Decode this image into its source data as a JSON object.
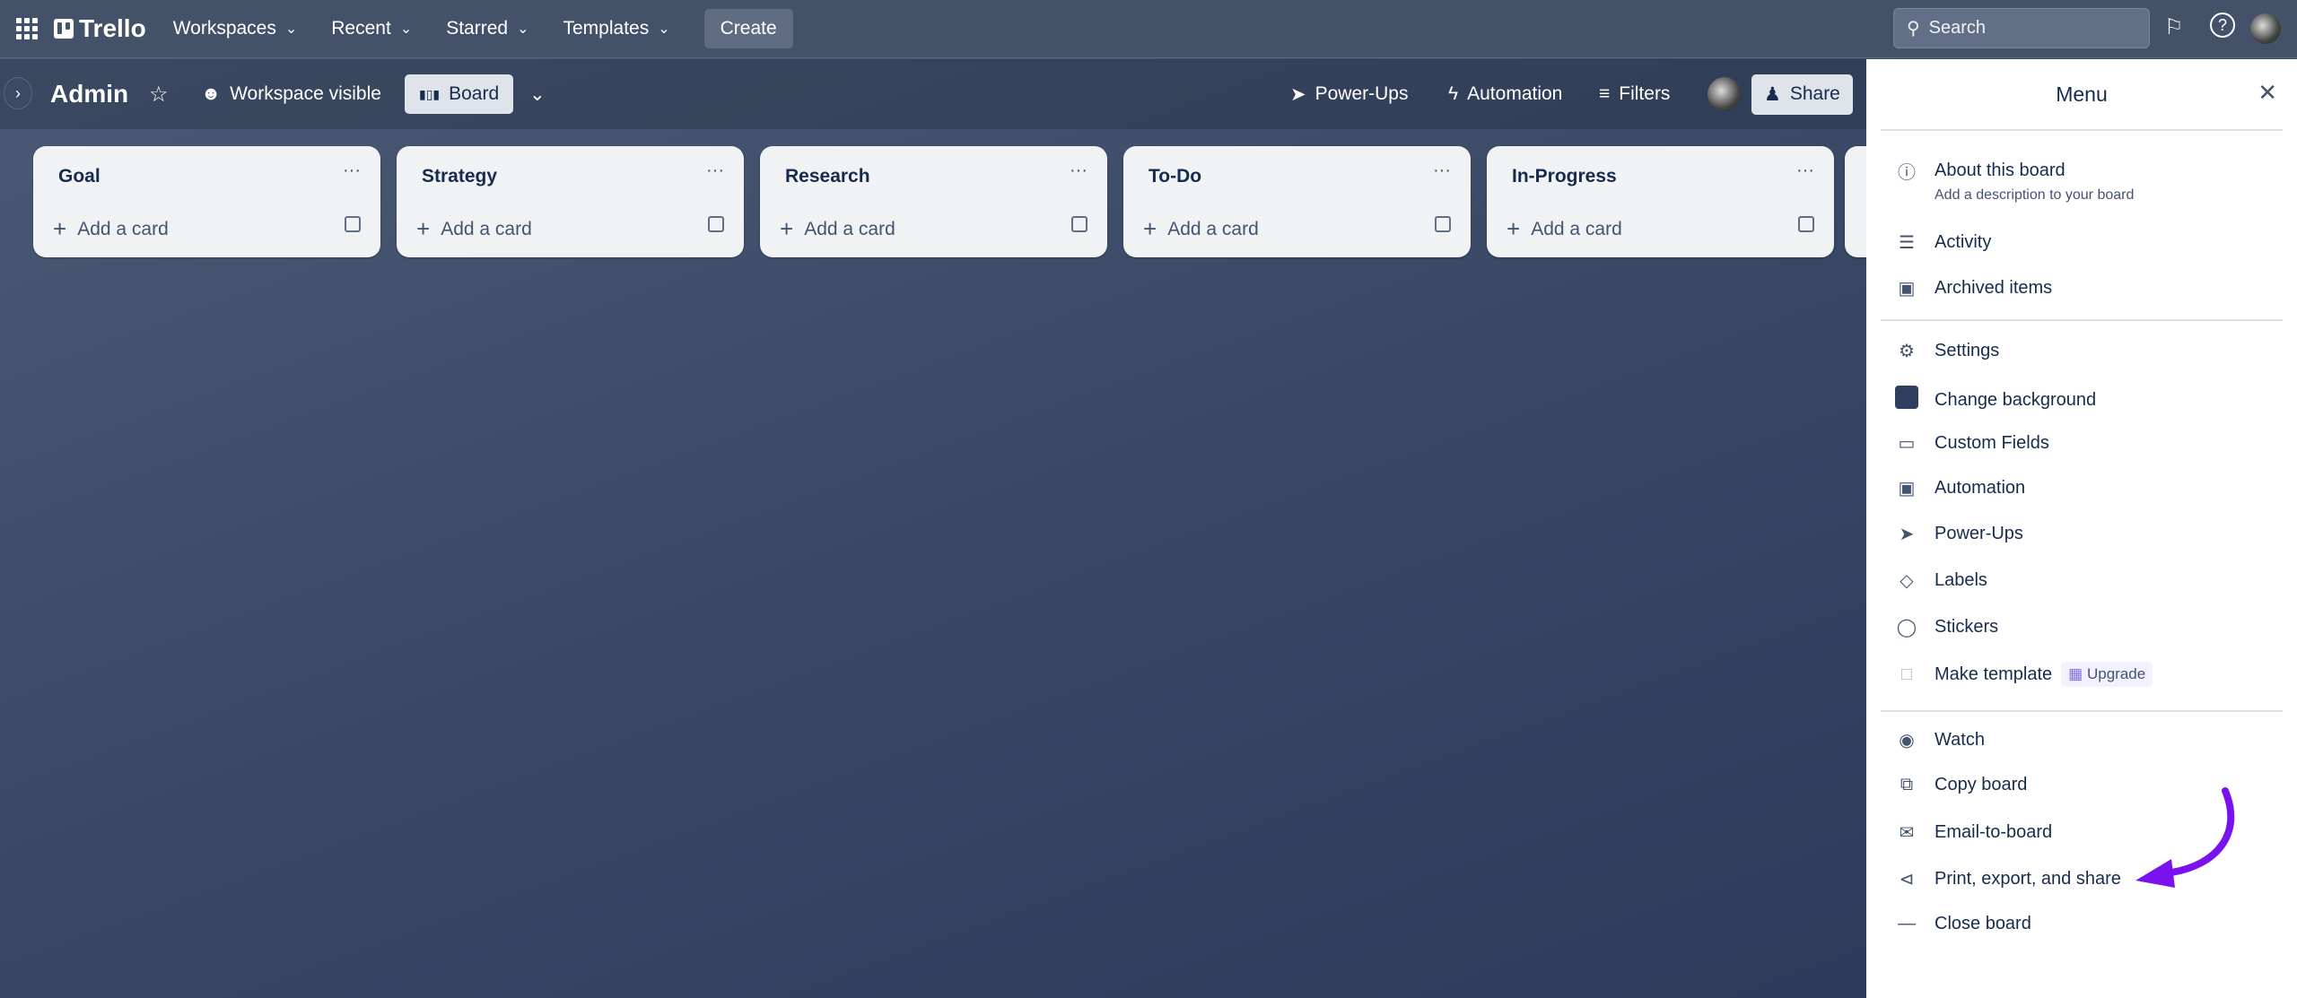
{
  "topbar": {
    "logo": "Trello",
    "nav": [
      "Workspaces",
      "Recent",
      "Starred",
      "Templates"
    ],
    "create_label": "Create",
    "search_placeholder": "Search"
  },
  "board": {
    "title": "Admin",
    "visibility": "Workspace visible",
    "view": "Board",
    "power_ups": "Power-Ups",
    "automation": "Automation",
    "filters": "Filters",
    "share": "Share"
  },
  "lists": [
    {
      "title": "Goal"
    },
    {
      "title": "Strategy"
    },
    {
      "title": "Research"
    },
    {
      "title": "To-Do"
    },
    {
      "title": "In-Progress"
    }
  ],
  "add_card_label": "Add a card",
  "menu": {
    "title": "Menu",
    "about": {
      "label": "About this board",
      "sub": "Add a description to your board"
    },
    "items": [
      "Activity",
      "Archived items",
      "Settings",
      "Change background",
      "Custom Fields",
      "Automation",
      "Power-Ups",
      "Labels",
      "Stickers",
      "Make template",
      "Watch",
      "Copy board",
      "Email-to-board",
      "Print, export, and share",
      "Close board"
    ],
    "upgrade": "Upgrade"
  },
  "colors": {
    "annotation_arrow": "#7a12f0",
    "menu_bg": "#ffffff",
    "topbar": "#435169"
  }
}
